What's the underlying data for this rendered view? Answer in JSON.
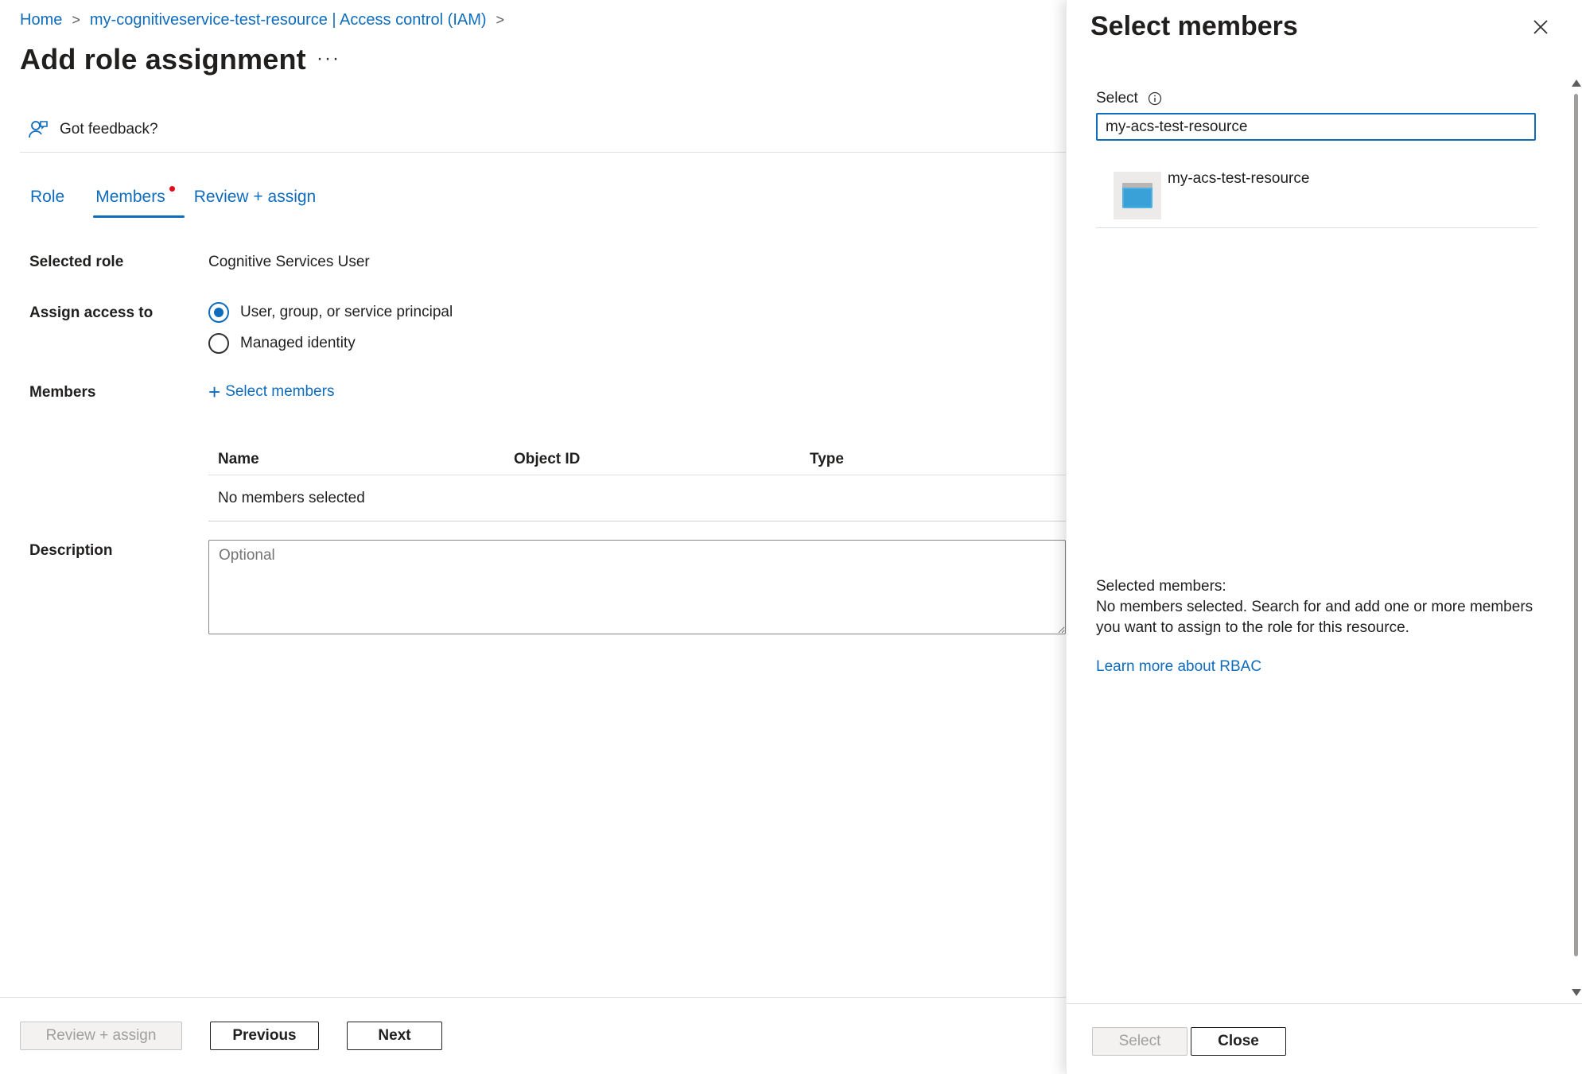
{
  "breadcrumb": {
    "home": "Home",
    "resource": "my-cognitiveservice-test-resource | Access control (IAM)",
    "separator": ">"
  },
  "page": {
    "title": "Add role assignment",
    "more": "···"
  },
  "feedback": {
    "label": "Got feedback?"
  },
  "tabs": {
    "role": "Role",
    "members": "Members",
    "review": "Review + assign"
  },
  "form": {
    "selected_role_label": "Selected role",
    "selected_role_value": "Cognitive Services User",
    "assign_access_label": "Assign access to",
    "assign_options": [
      {
        "label": "User, group, or service principal",
        "selected": true
      },
      {
        "label": "Managed identity",
        "selected": false
      }
    ],
    "members_label": "Members",
    "select_members_link": "Select members",
    "table": {
      "columns": [
        "Name",
        "Object ID",
        "Type"
      ],
      "empty_text": "No members selected"
    },
    "description_label": "Description",
    "description_placeholder": "Optional"
  },
  "footer": {
    "review_assign": "Review + assign",
    "previous": "Previous",
    "next": "Next"
  },
  "panel": {
    "title": "Select members",
    "select_label": "Select",
    "search_value": "my-acs-test-resource",
    "results": [
      {
        "name": "my-acs-test-resource",
        "icon": "cognitive-resource-icon"
      }
    ],
    "selected_members_heading": "Selected members:",
    "selected_members_text": "No members selected. Search for and add one or more members you want to assign to the role for this resource.",
    "learn_more": "Learn more about RBAC",
    "select_button": "Select",
    "close_button": "Close"
  },
  "colors": {
    "accent": "#0f6cbd",
    "notification_dot": "#e00b1c"
  }
}
